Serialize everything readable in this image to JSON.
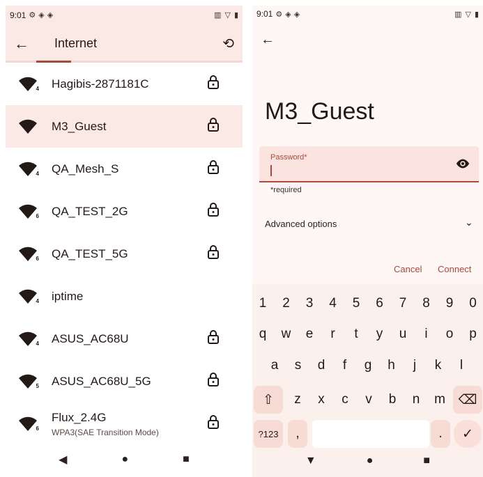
{
  "left": {
    "status": {
      "time": "9:01"
    },
    "appbar": {
      "title": "Internet"
    },
    "networks": [
      {
        "ssid": "Hagibis-2871181C",
        "badge": "4",
        "sub": "",
        "locked": true,
        "selected": false
      },
      {
        "ssid": "M3_Guest",
        "badge": "",
        "sub": "",
        "locked": true,
        "selected": true
      },
      {
        "ssid": "QA_Mesh_S",
        "badge": "4",
        "sub": "",
        "locked": true,
        "selected": false
      },
      {
        "ssid": "QA_TEST_2G",
        "badge": "6",
        "sub": "",
        "locked": true,
        "selected": false
      },
      {
        "ssid": "QA_TEST_5G",
        "badge": "6",
        "sub": "",
        "locked": true,
        "selected": false
      },
      {
        "ssid": "iptime",
        "badge": "4",
        "sub": "",
        "locked": false,
        "selected": false
      },
      {
        "ssid": "ASUS_AC68U",
        "badge": "4",
        "sub": "",
        "locked": true,
        "selected": false
      },
      {
        "ssid": "ASUS_AC68U_5G",
        "badge": "5",
        "sub": "",
        "locked": true,
        "selected": false
      },
      {
        "ssid": "Flux_2.4G",
        "badge": "6",
        "sub": "WPA3(SAE Transition Mode)",
        "locked": true,
        "selected": false
      }
    ]
  },
  "right": {
    "status": {
      "time": "9:01"
    },
    "network_title": "M3_Guest",
    "password": {
      "label": "Password*",
      "value": "",
      "helper": "*required"
    },
    "advanced_label": "Advanced options",
    "buttons": {
      "cancel": "Cancel",
      "connect": "Connect"
    },
    "keyboard": {
      "row1": [
        "1",
        "2",
        "3",
        "4",
        "5",
        "6",
        "7",
        "8",
        "9",
        "0"
      ],
      "row2": [
        "q",
        "w",
        "e",
        "r",
        "t",
        "y",
        "u",
        "i",
        "o",
        "p"
      ],
      "row3": [
        "a",
        "s",
        "d",
        "f",
        "g",
        "h",
        "j",
        "k",
        "l"
      ],
      "row4": [
        "z",
        "x",
        "c",
        "v",
        "b",
        "n",
        "m"
      ],
      "symbols_label": "?123",
      "comma": ",",
      "period": "."
    }
  },
  "colors": {
    "accent": "#a84b3c",
    "surface": "#fbe9e5"
  }
}
